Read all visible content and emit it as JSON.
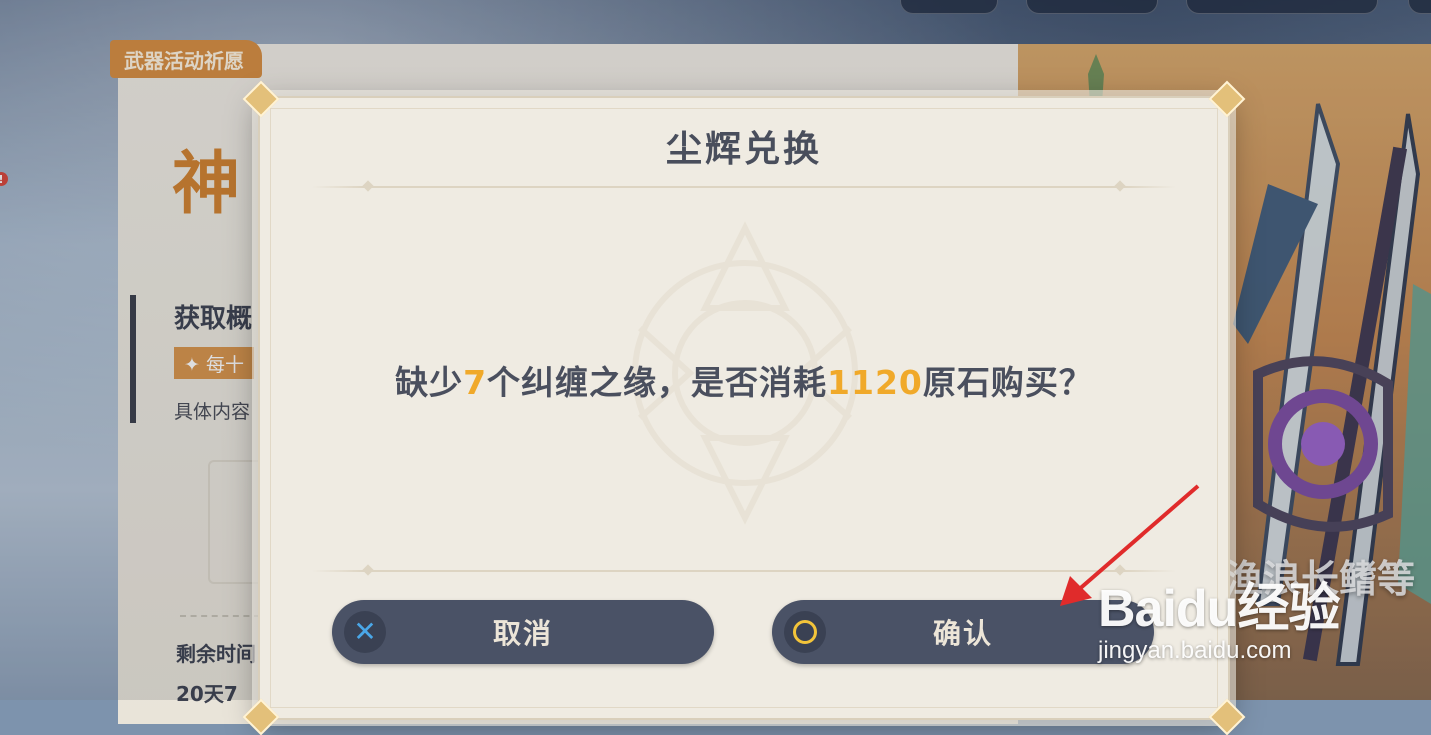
{
  "background": {
    "banner_tag": "武器活动祈愿",
    "banner_big_title": "神",
    "banner_subtitle": "获取概",
    "banner_chip": "✦ 每十",
    "banner_desc": "具体内容",
    "remaining_label": "剩余时间",
    "remaining_value": "20天7",
    "weapon_name": "渔浪长鳍等"
  },
  "dialog": {
    "title": "尘辉兑换",
    "message": {
      "part1": "缺少",
      "missing_count": "7",
      "part2": "个纠缠之缘，是否消耗",
      "cost": "1120",
      "part3": "原石购买？"
    },
    "cancel": {
      "label": "取消",
      "icon": "cross-icon"
    },
    "confirm": {
      "label": "确认",
      "icon": "circle-icon"
    }
  },
  "watermark": {
    "logo": "Baidu经验",
    "url": "jingyan.baidu.com"
  },
  "colors": {
    "highlight": "#f0a92a",
    "button_bg": "#4a5266",
    "dialog_bg": "#efebe2",
    "annotation_arrow": "#e02b2b"
  }
}
